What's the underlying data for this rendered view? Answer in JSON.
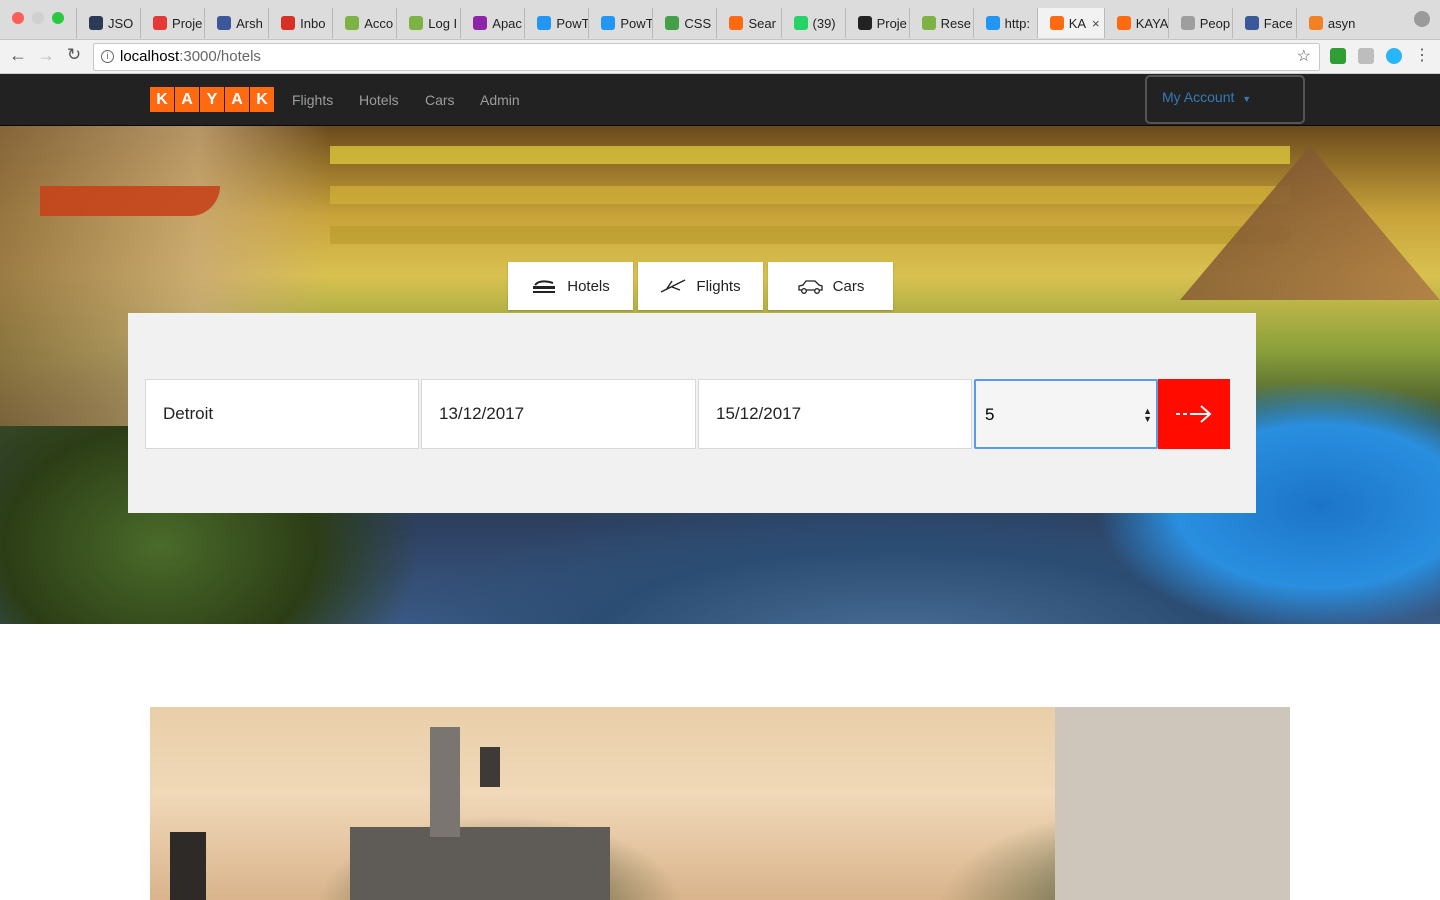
{
  "browser": {
    "tabs": [
      {
        "label": "JSO",
        "fav": "#2b3a55"
      },
      {
        "label": "Proje",
        "fav": "#e53935"
      },
      {
        "label": "Arsh",
        "fav": "#3b5998"
      },
      {
        "label": "Inbo",
        "fav": "#d93025"
      },
      {
        "label": "Acco",
        "fav": "#7cb342"
      },
      {
        "label": "Log I",
        "fav": "#7cb342"
      },
      {
        "label": "Apac",
        "fav": "#8e24aa"
      },
      {
        "label": "PowT",
        "fav": "#2196f3"
      },
      {
        "label": "PowT",
        "fav": "#2196f3"
      },
      {
        "label": "CSS",
        "fav": "#43a047"
      },
      {
        "label": "Sear",
        "fav": "#ff690f"
      },
      {
        "label": "(39)",
        "fav": "#25d366"
      },
      {
        "label": "Proje",
        "fav": "#222222"
      },
      {
        "label": "Rese",
        "fav": "#7cb342"
      },
      {
        "label": "http:",
        "fav": "#2196f3"
      },
      {
        "label": "KA",
        "fav": "#ff690f",
        "active": true
      },
      {
        "label": "KAYA",
        "fav": "#ff690f"
      },
      {
        "label": "Peop",
        "fav": "#9e9e9e"
      },
      {
        "label": "Face",
        "fav": "#3b5998"
      },
      {
        "label": "asyn",
        "fav": "#f48024"
      }
    ],
    "url_host": "localhost",
    "url_path": ":3000/hotels"
  },
  "nav": {
    "logo_letters": [
      "K",
      "A",
      "Y",
      "A",
      "K"
    ],
    "links": [
      "Flights",
      "Hotels",
      "Cars",
      "Admin"
    ],
    "account": "My Account"
  },
  "search": {
    "tabs": [
      "Hotels",
      "Flights",
      "Cars"
    ],
    "destination": "Detroit",
    "checkin": "13/12/2017",
    "checkout": "15/12/2017",
    "guests": "5"
  },
  "colors": {
    "brand": "#ff690f",
    "navbar": "#222222",
    "search_button": "#ff0b00",
    "account_link": "#337ab7"
  }
}
